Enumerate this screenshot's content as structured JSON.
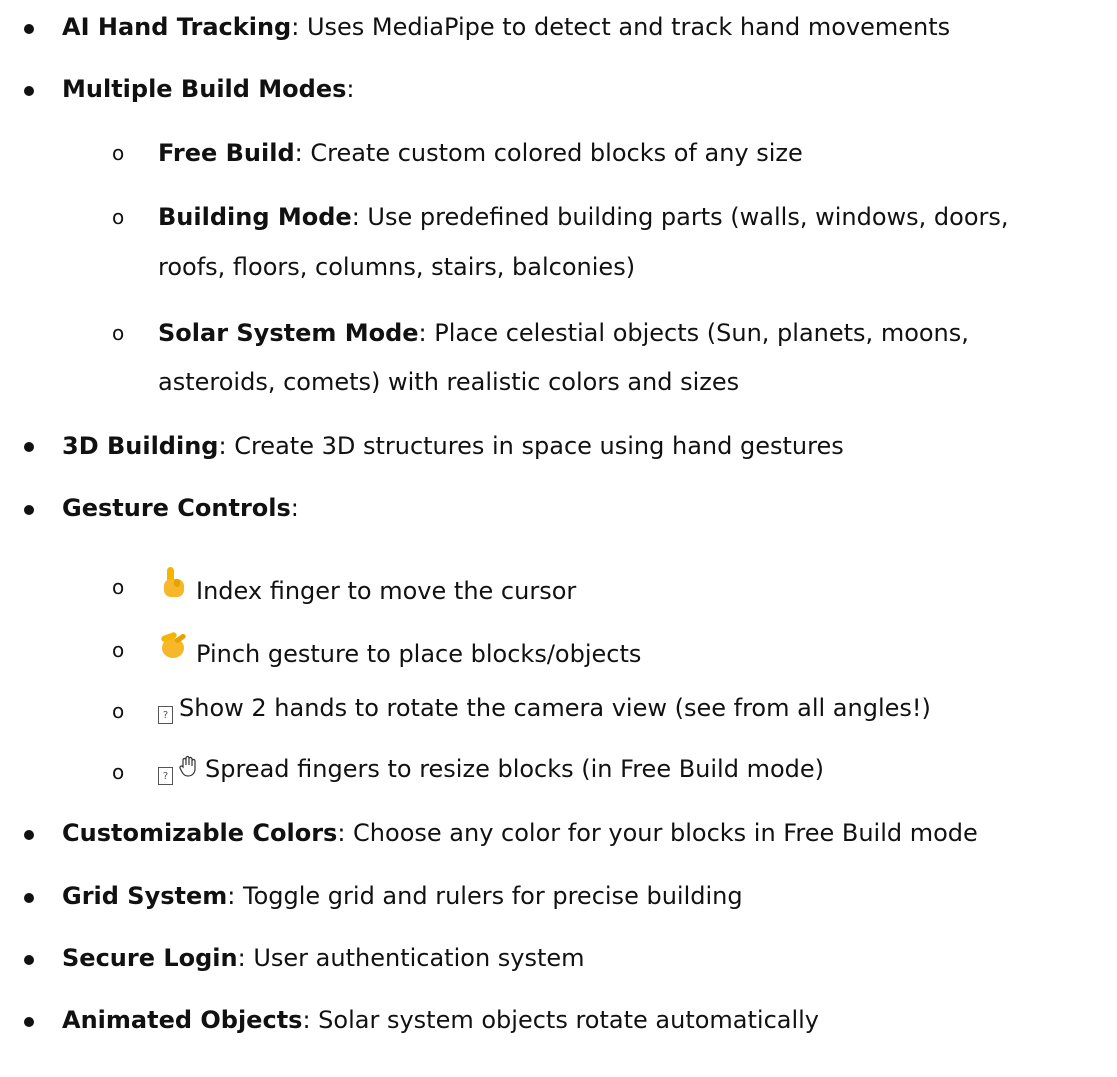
{
  "items": [
    {
      "title": "AI Hand Tracking",
      "sep": ":",
      "text": " Uses MediaPipe to detect and track hand movements"
    },
    {
      "title": "Multiple Build Modes",
      "sep": ":",
      "text": ""
    },
    {
      "title": "Free Build",
      "sep": ":",
      "text": " Create custom colored blocks of any size"
    },
    {
      "title": "Building Mode",
      "sep": ":",
      "text": " Use predefined building parts (walls, windows, doors,",
      "cont": "roofs, floors, columns, stairs, balconies)"
    },
    {
      "title": "Solar System Mode",
      "sep": ":",
      "text": " Place celestial objects (Sun, planets, moons,",
      "cont": "asteroids, comets) with realistic colors and sizes"
    },
    {
      "title": "3D Building",
      "sep": ":",
      "text": " Create 3D structures in space using hand gestures"
    },
    {
      "title": "Gesture Controls",
      "sep": ":",
      "text": ""
    },
    {
      "text": "Index finger to move the cursor"
    },
    {
      "text": "Pinch gesture to place blocks/objects"
    },
    {
      "text": "Show 2 hands to rotate the camera view (see from all angles!)"
    },
    {
      "text": "Spread fingers to resize blocks (in Free Build mode)"
    },
    {
      "title": "Customizable Colors",
      "sep": ":",
      "text": " Choose any color for your blocks in Free Build mode"
    },
    {
      "title": "Grid System",
      "sep": ":",
      "text": " Toggle grid and rulers for precise building"
    },
    {
      "title": "Secure Login",
      "sep": ":",
      "text": " User authentication system"
    },
    {
      "title": "Animated Objects",
      "sep": ":",
      "text": " Solar system objects rotate automatically"
    }
  ],
  "sub_marker": "o",
  "icons": {
    "pointing": "pointing-finger-icon",
    "pinch": "pinch-hand-icon",
    "missing_glyph": "missing-glyph-icon",
    "raised_hand": "raised-hand-outline-icon"
  }
}
